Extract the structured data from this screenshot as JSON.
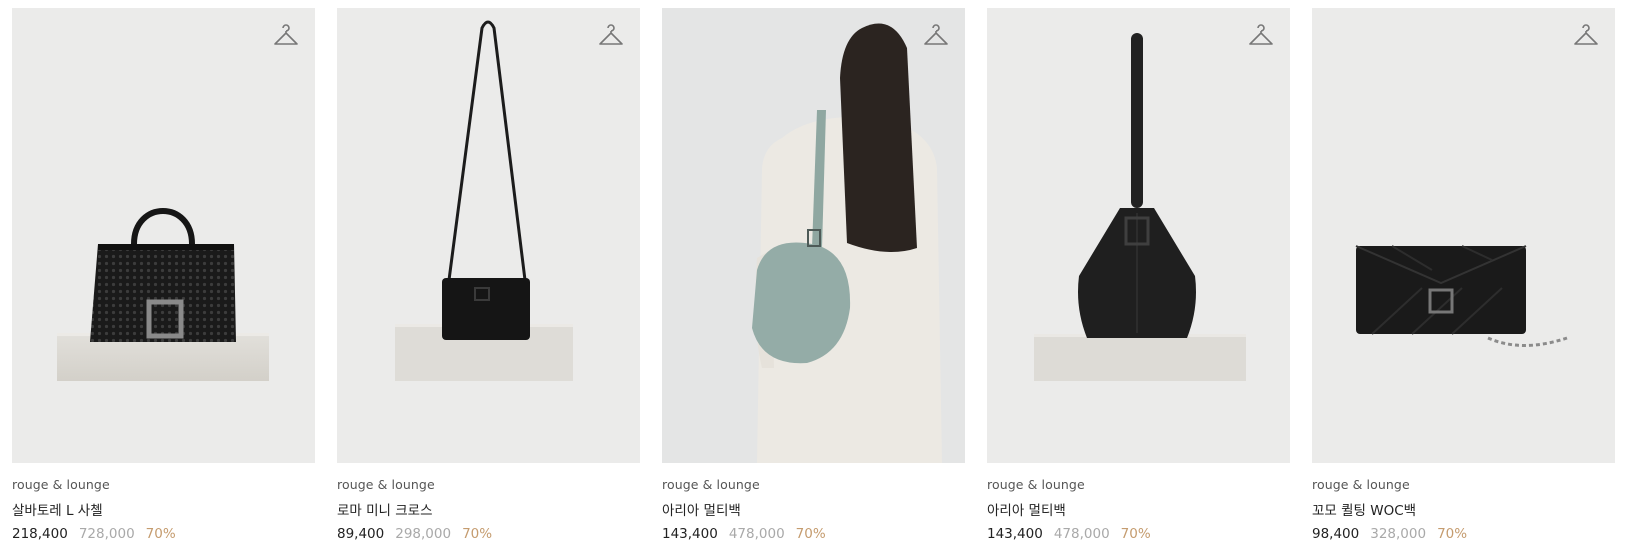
{
  "products": [
    {
      "brand": "rouge & lounge",
      "name": "살바토레 L 사첼",
      "price": "218,400",
      "original_price": "728,000",
      "discount": "70%",
      "icon": "hanger-icon"
    },
    {
      "brand": "rouge & lounge",
      "name": "로마 미니 크로스",
      "price": "89,400",
      "original_price": "298,000",
      "discount": "70%",
      "icon": "hanger-icon"
    },
    {
      "brand": "rouge & lounge",
      "name": "아리아 멀티백",
      "price": "143,400",
      "original_price": "478,000",
      "discount": "70%",
      "icon": "hanger-icon"
    },
    {
      "brand": "rouge & lounge",
      "name": "아리아 멀티백",
      "price": "143,400",
      "original_price": "478,000",
      "discount": "70%",
      "icon": "hanger-icon"
    },
    {
      "brand": "rouge & lounge",
      "name": "꼬모 퀼팅 WOC백",
      "price": "98,400",
      "original_price": "328,000",
      "discount": "70%",
      "icon": "hanger-icon"
    }
  ],
  "colors": {
    "card_bg": "#ebebea",
    "price": "#222222",
    "original_price": "#a9a9a9",
    "discount": "#c59c6f"
  }
}
